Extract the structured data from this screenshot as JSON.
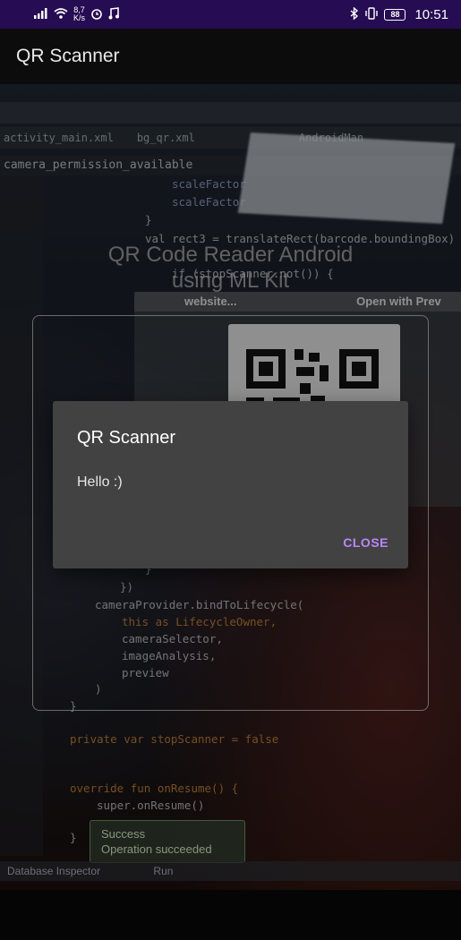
{
  "status_bar": {
    "speed_value": "8,7",
    "speed_unit": "K/s",
    "battery": "88",
    "time": "10:51"
  },
  "app_bar": {
    "title": "QR Scanner"
  },
  "camera_preview": {
    "ide_tabs": [
      "activity_main.xml",
      "bg_qr.xml",
      "AndroidMan"
    ],
    "ide_breadcrumb": "camera_permission_available",
    "code_lines": [
      "scaleFactor",
      "scaleFactor",
      "}",
      "val rect3 = translateRect(barcode.boundingBox)",
      "if (stopScanner.not()) {",
      "}",
      "})",
      "cameraProvider.bindToLifecycle(",
      "this as LifecycleOwner,",
      "cameraSelector,",
      "imageAnalysis,",
      "preview",
      ")",
      "}",
      "private var stopScanner = false",
      "override fun onResume() {",
      "super.onResume()",
      "}"
    ],
    "mini_window_title": "website...",
    "mini_window_action": "Open with Prev",
    "ide_bottom_left": "Database Inspector",
    "ide_bottom_run": "Run",
    "toast_title": "Success",
    "toast_message": "Operation succeeded"
  },
  "scanner": {
    "title_line1": "QR Code Reader Android",
    "title_line2": "using ML Kit"
  },
  "dialog": {
    "title": "QR Scanner",
    "message": "Hello :)",
    "button_label": "CLOSE"
  },
  "colors": {
    "status_bar_bg": "#260c52",
    "dialog_bg": "#424242",
    "accent": "#bb86fc"
  }
}
